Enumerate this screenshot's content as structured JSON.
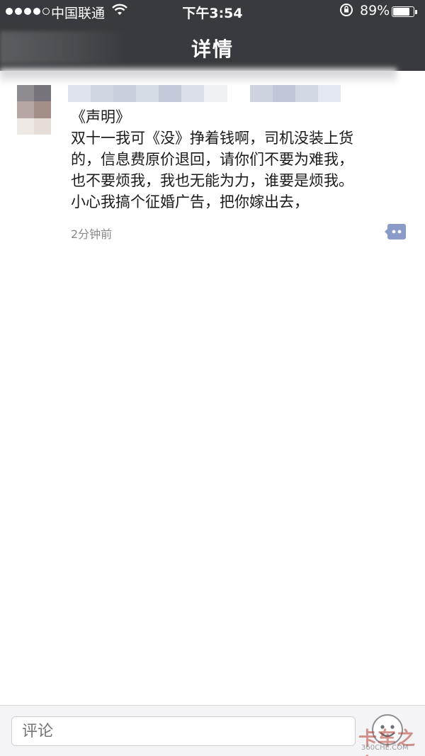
{
  "status_bar": {
    "carrier": "中国联通",
    "time": "下午3:54",
    "battery_percent": "89%",
    "battery_level": 0.89,
    "signal_icon": "signal-dots-icon",
    "wifi_icon": "wifi-icon",
    "lock_icon": "rotation-lock-icon"
  },
  "nav": {
    "title": "详情"
  },
  "post": {
    "lines": [
      "《声明》",
      "双十一我可《没》挣着钱啊，司机没装上货",
      "的，信息费原价退回，请你们不要为难我，",
      "也不要烦我，我也无能为力，谁要是烦我。",
      "小心我搞个征婚广告，把你嫁出去，"
    ],
    "timestamp": "2分钟前",
    "comment_icon": "comment-bubble-icon"
  },
  "comment_bar": {
    "placeholder": "评论",
    "emoji_icon": "emoji-face-icon"
  },
  "watermark": {
    "text": "卡车之家",
    "sub": "360CHE.COM"
  },
  "colors": {
    "topbar": "#393a3f",
    "accent_icon": "#8a9bc9",
    "timestamp": "#8a8a8a"
  }
}
